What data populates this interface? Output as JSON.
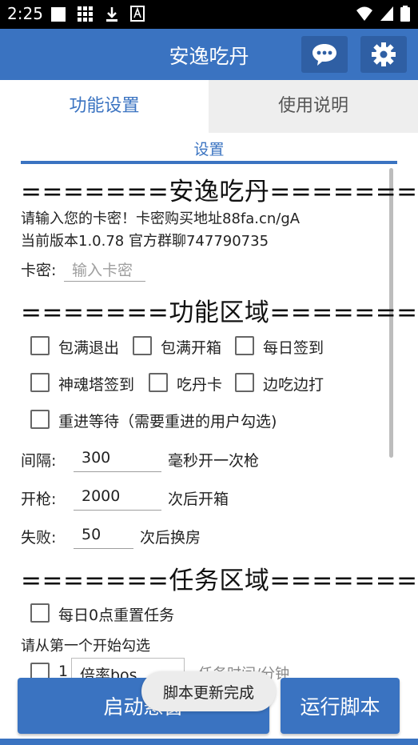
{
  "status_bar": {
    "time": "2:25",
    "icons_left": [
      "notification-square-icon",
      "grid-icon",
      "download-icon",
      "font-box-icon"
    ],
    "icons_right": [
      "wifi-icon",
      "signal-icon",
      "battery-icon"
    ]
  },
  "app_bar": {
    "title": "安逸吃丹",
    "chat_icon": "chat-bubble-icon",
    "settings_icon": "gear-icon"
  },
  "tabs": [
    {
      "label": "功能设置",
      "active": true
    },
    {
      "label": "使用说明",
      "active": false
    }
  ],
  "settings_section": {
    "label": "设置"
  },
  "header_block": {
    "title": "=======安逸吃丹=======",
    "line1": "请输入您的卡密！卡密购买地址88fa.cn/gA",
    "line2": "当前版本1.0.78   官方群聊747790735",
    "card_label": "卡密:",
    "card_placeholder": "输入卡密",
    "card_value": ""
  },
  "feature_block": {
    "title": "=======功能区域=======",
    "checkboxes": [
      {
        "label": "包满退出",
        "checked": false
      },
      {
        "label": "包满开箱",
        "checked": false
      },
      {
        "label": "每日签到",
        "checked": false
      },
      {
        "label": "神魂塔签到",
        "checked": false
      },
      {
        "label": "吃丹卡",
        "checked": false
      },
      {
        "label": "边吃边打",
        "checked": false
      },
      {
        "label": "重进等待（需要重进的用户勾选)",
        "checked": false
      }
    ],
    "interval_label": "间隔:",
    "interval_value": "300",
    "interval_suffix": "毫秒开一次枪",
    "fire_label": "开枪:",
    "fire_value": "2000",
    "fire_suffix": "次后开箱",
    "fail_label": "失败:",
    "fail_value": "50",
    "fail_suffix": "次后换房"
  },
  "task_block": {
    "title": "=======任务区域=======",
    "reset_checkbox": {
      "label": "每日0点重置任务",
      "checked": false
    },
    "hint": "请从第一个开始勾选",
    "row_index": "1",
    "row_partial_value": "倍率bos",
    "row_partial_suffix": "任务时间/分钟"
  },
  "buttons": {
    "start": "启动悬窗",
    "run": "运行脚本"
  },
  "toast": "脚本更新完成",
  "colors": {
    "primary": "#3a73c1",
    "primary_dark": "#2f5fa4",
    "tab_inactive_bg": "#eeeeee"
  }
}
